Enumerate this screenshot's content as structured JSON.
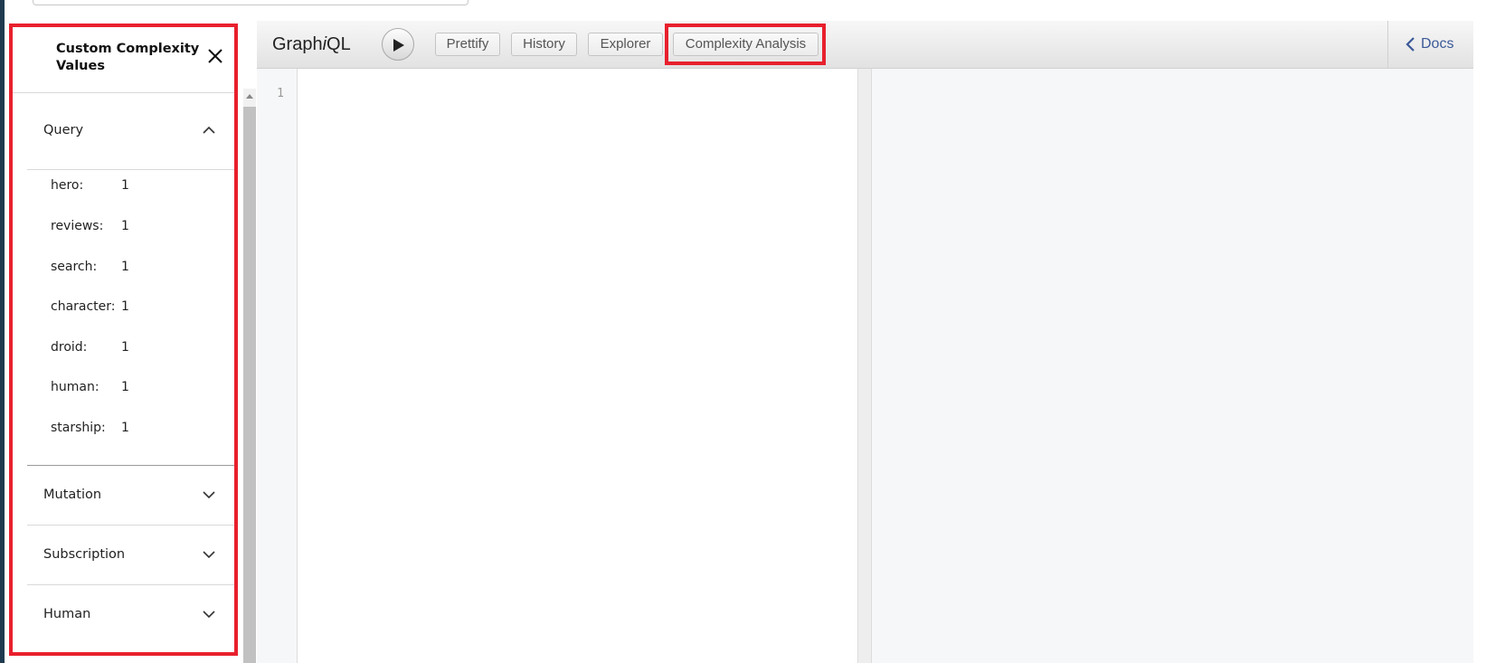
{
  "sidebar": {
    "title": "Custom Complexity Values",
    "sections": {
      "query": {
        "label": "Query",
        "expanded": true
      },
      "mutation": {
        "label": "Mutation",
        "expanded": false
      },
      "subscription": {
        "label": "Subscription",
        "expanded": false
      },
      "human": {
        "label": "Human",
        "expanded": false
      }
    },
    "query_fields": [
      {
        "name": "hero:",
        "value": "1"
      },
      {
        "name": "reviews:",
        "value": "1"
      },
      {
        "name": "search:",
        "value": "1"
      },
      {
        "name": "character:",
        "value": "1"
      },
      {
        "name": "droid:",
        "value": "1"
      },
      {
        "name": "human:",
        "value": "1"
      },
      {
        "name": "starship:",
        "value": "1"
      }
    ]
  },
  "graphiql": {
    "logo_prefix": "Graph",
    "logo_italic": "i",
    "logo_suffix": "QL",
    "toolbar": {
      "prettify": "Prettify",
      "history": "History",
      "explorer": "Explorer",
      "complexity": "Complexity Analysis"
    },
    "docs_label": "Docs",
    "editor": {
      "line_number": "1"
    }
  },
  "colors": {
    "highlight": "#e8202d",
    "docs_link": "#3b5998"
  },
  "icons": {
    "close": "close-icon",
    "chevron_up": "chevron-up-icon",
    "chevron_down": "chevron-down-icon",
    "play": "play-icon",
    "docs_back": "chevron-left-icon"
  }
}
